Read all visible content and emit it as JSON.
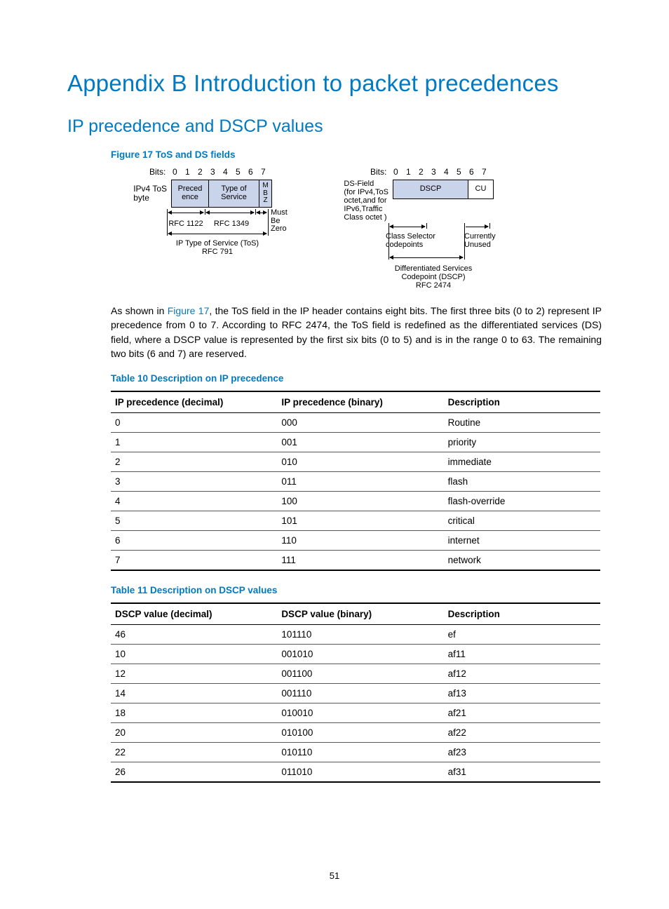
{
  "title": "Appendix B Introduction to packet precedences",
  "subtitle": "IP precedence and DSCP values",
  "figure_caption": "Figure 17 ToS and DS fields",
  "figure": {
    "bits_label": "Bits:",
    "bits": [
      "0",
      "1",
      "2",
      "3",
      "4",
      "5",
      "6",
      "7"
    ],
    "left": {
      "side_label": "IPv4 ToS\nbyte",
      "cells": [
        "Preced\nence",
        "Type of\nService",
        "M\nB\nZ"
      ],
      "rfc1122": "RFC 1122",
      "rfc1349": "RFC 1349",
      "mbz": "Must\nBe\nZero",
      "bottom": "IP Type of Service (ToS)\nRFC 791"
    },
    "right": {
      "side_label": "DS-Field\n(for IPv4,ToS\noctet,and for\nIPv6,Traffic\nClass octet )",
      "cells": [
        "DSCP",
        "CU"
      ],
      "class_sel": "Class Selector\ncodepoints",
      "cu": "Currently\nUnused",
      "bottom": "Differentiated Services\nCodepoint (DSCP)\nRFC 2474"
    }
  },
  "paragraph": {
    "pre": "As shown in ",
    "link": "Figure 17",
    "post": ", the ToS field in the IP header contains eight bits. The first three bits (0 to 2) represent IP precedence from 0 to 7. According to RFC 2474, the ToS field is redefined as the differentiated services (DS) field, where a DSCP value is represented by the first six bits (0 to 5) and is in the range 0 to 63. The remaining two bits (6 and 7) are reserved."
  },
  "table10": {
    "caption": "Table 10 Description on IP precedence",
    "headers": [
      "IP precedence (decimal)",
      "IP precedence (binary)",
      "Description"
    ],
    "rows": [
      [
        "0",
        "000",
        "Routine"
      ],
      [
        "1",
        "001",
        "priority"
      ],
      [
        "2",
        "010",
        "immediate"
      ],
      [
        "3",
        "011",
        "flash"
      ],
      [
        "4",
        "100",
        "flash-override"
      ],
      [
        "5",
        "101",
        "critical"
      ],
      [
        "6",
        "110",
        "internet"
      ],
      [
        "7",
        "111",
        "network"
      ]
    ]
  },
  "table11": {
    "caption": "Table 11 Description on DSCP values",
    "headers": [
      "DSCP value (decimal)",
      "DSCP value (binary)",
      "Description"
    ],
    "rows": [
      [
        "46",
        "101110",
        "ef"
      ],
      [
        "10",
        "001010",
        "af11"
      ],
      [
        "12",
        "001100",
        "af12"
      ],
      [
        "14",
        "001110",
        "af13"
      ],
      [
        "18",
        "010010",
        "af21"
      ],
      [
        "20",
        "010100",
        "af22"
      ],
      [
        "22",
        "010110",
        "af23"
      ],
      [
        "26",
        "011010",
        "af31"
      ]
    ]
  },
  "page_number": "51"
}
